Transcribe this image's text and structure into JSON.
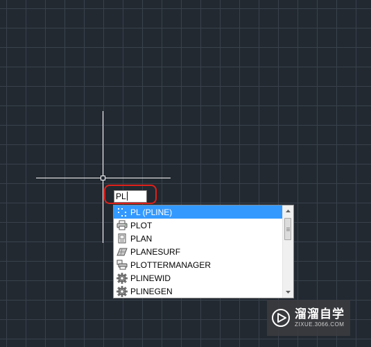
{
  "command_line": {
    "input_value": "PL"
  },
  "autocomplete": {
    "items": [
      {
        "label": "PL (PLINE)",
        "icon": "pline-icon",
        "selected": true
      },
      {
        "label": "PLOT",
        "icon": "printer-icon",
        "selected": false
      },
      {
        "label": "PLAN",
        "icon": "plan-view-icon",
        "selected": false
      },
      {
        "label": "PLANESURF",
        "icon": "planar-surface-icon",
        "selected": false
      },
      {
        "label": "PLOTTERMANAGER",
        "icon": "plotter-manager-icon",
        "selected": false
      },
      {
        "label": "PLINEWID",
        "icon": "gear-icon",
        "selected": false
      },
      {
        "label": "PLINEGEN",
        "icon": "gear-icon",
        "selected": false
      }
    ]
  },
  "watermark": {
    "main": "溜溜自学",
    "sub": "ZIXUE.3066.COM"
  },
  "colors": {
    "canvas_background": "#222931",
    "grid_line": "#39414b",
    "selection": "#3399ff",
    "highlight_ring": "#e0201a"
  }
}
